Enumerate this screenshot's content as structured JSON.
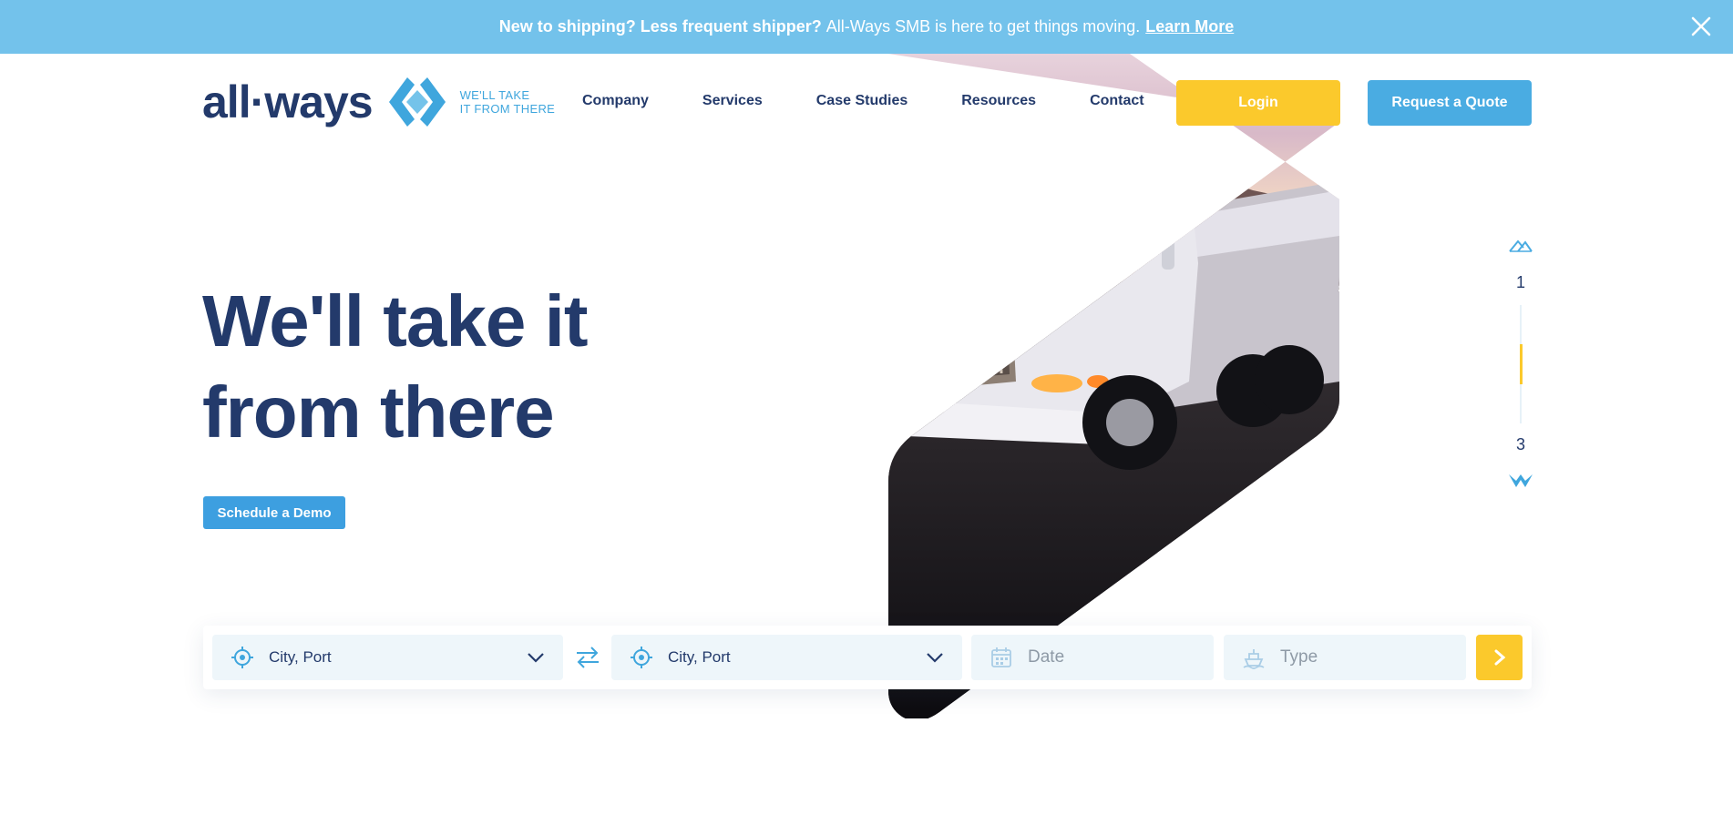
{
  "announcement": {
    "bold_text": "New to shipping? Less frequent shipper?",
    "text": "All-Ways SMB is here to get things moving.",
    "link": "Learn More",
    "close_icon": "close-icon"
  },
  "header": {
    "logo_text": "all·ways",
    "tagline_line1": "WE'LL TAKE",
    "tagline_line2": "IT FROM THERE",
    "nav": [
      "Company",
      "Services",
      "Case Studies",
      "Resources",
      "Contact"
    ],
    "login_label": "Login",
    "quote_label": "Request a Quote"
  },
  "hero": {
    "headline_line1": "We'll take it",
    "headline_line2": "from there",
    "demo_label": "Schedule a Demo",
    "image": "truck-photo"
  },
  "pager": {
    "current": "1",
    "total": "3",
    "progress": 0.33,
    "up_icon": "chevron-up-icon",
    "down_icon": "chevron-down-icon"
  },
  "search": {
    "origin_value": "City, Port",
    "destination_value": "City, Port",
    "date_placeholder": "Date",
    "type_placeholder": "Type",
    "origin_icon": "location-target-icon",
    "swap_icon": "swap-arrows-icon",
    "date_icon": "calendar-icon",
    "type_icon": "ship-icon",
    "submit_icon": "chevron-right-icon"
  },
  "colors": {
    "announcement_bg": "#73c2eb",
    "navy": "#233a6b",
    "brand_blue": "#4aace2",
    "yellow": "#fbc92c",
    "field_bg": "#eef6fa"
  }
}
